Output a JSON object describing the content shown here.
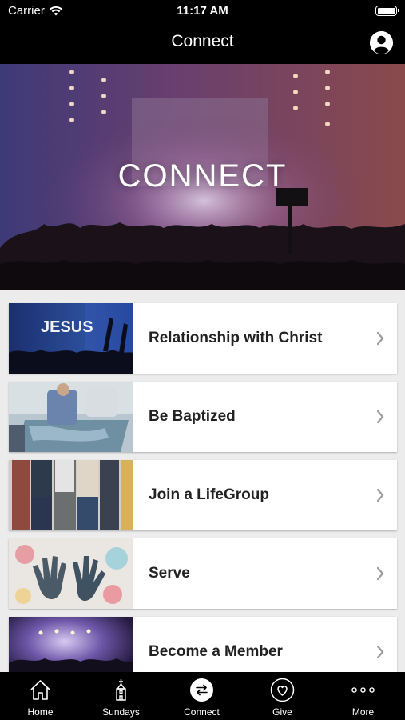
{
  "status_bar": {
    "carrier": "Carrier",
    "time": "11:17 AM"
  },
  "nav": {
    "title": "Connect"
  },
  "hero": {
    "title": "CONNECT"
  },
  "list": {
    "items": [
      {
        "label": "Relationship with Christ",
        "thumb_text": "JESUS"
      },
      {
        "label": "Be Baptized"
      },
      {
        "label": "Join a LifeGroup"
      },
      {
        "label": "Serve"
      },
      {
        "label": "Become a Member"
      }
    ]
  },
  "tab_bar": {
    "tabs": [
      {
        "label": "Home",
        "icon": "home-icon"
      },
      {
        "label": "Sundays",
        "icon": "church-icon"
      },
      {
        "label": "Connect",
        "icon": "connect-arrows-icon",
        "active": true
      },
      {
        "label": "Give",
        "icon": "heart-icon"
      },
      {
        "label": "More",
        "icon": "more-dots-icon"
      }
    ]
  },
  "colors": {
    "bar_background": "#000000",
    "list_background": "#ececec",
    "card_background": "#ffffff",
    "label_text": "#222222"
  }
}
